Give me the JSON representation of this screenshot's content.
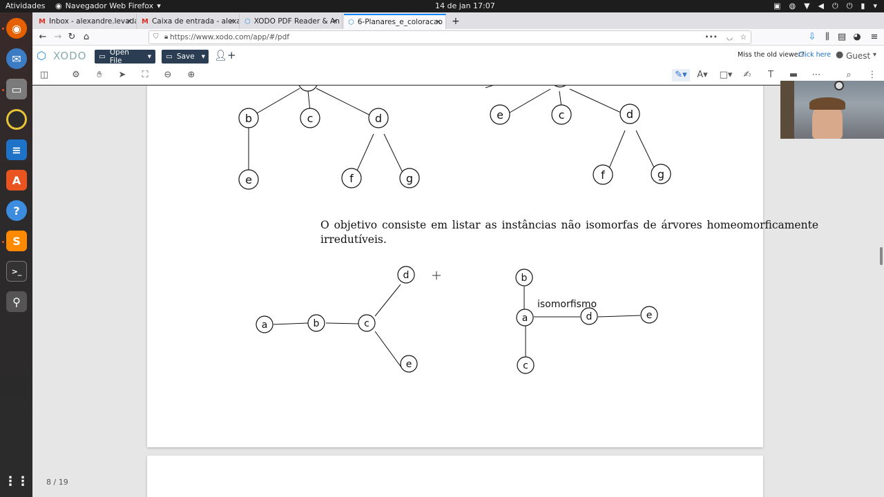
{
  "os": {
    "activities": "Atividades",
    "app_menu": "Navegador Web Firefox",
    "clock": "14 de jan  17:07"
  },
  "tabs": [
    {
      "label": "Inbox - alexandre.levada",
      "icon": "gmail-icon"
    },
    {
      "label": "Caixa de entrada - alexa",
      "icon": "gmail-icon"
    },
    {
      "label": "XODO PDF Reader & An",
      "icon": "xodo-icon"
    },
    {
      "label": "6-Planares_e_coloracao",
      "icon": "xodo-icon",
      "active": true
    }
  ],
  "url": "https://www.xodo.com/app/#/pdf",
  "xodo": {
    "logo": "XODO",
    "open_file": "Open File",
    "save": "Save",
    "old_viewer": "Miss the old viewer?",
    "click_here": "Click here",
    "guest": "Guest"
  },
  "document": {
    "paragraph": "O objetivo consiste em listar as instâncias não isomorfas de árvores homeomorficamente irredutíveis.",
    "iso_label": "isomorfismo",
    "tree1_nodes": [
      "b",
      "c",
      "d",
      "e",
      "f",
      "g"
    ],
    "tree2_nodes": [
      "e",
      "c",
      "d",
      "f",
      "g"
    ],
    "graph1_nodes": [
      "a",
      "b",
      "c",
      "d",
      "e"
    ],
    "graph2_nodes": [
      "b",
      "a",
      "d",
      "e",
      "c"
    ]
  },
  "viewer": {
    "page_indicator": "8 / 19"
  }
}
